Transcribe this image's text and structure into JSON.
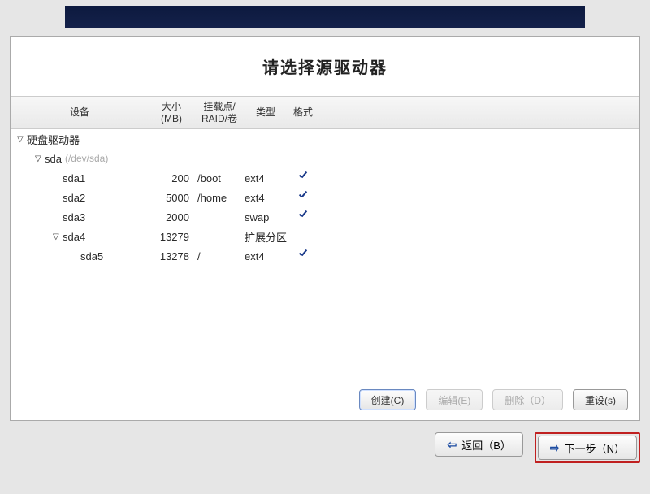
{
  "title": "请选择源驱动器",
  "columns": {
    "device": "设备",
    "size": "大小\n(MB)",
    "mount": "挂载点/\nRAID/卷",
    "type": "类型",
    "format": "格式"
  },
  "tree": {
    "root_label": "硬盘驱动器",
    "disk": {
      "name": "sda",
      "path": "(/dev/sda)"
    },
    "partitions": [
      {
        "name": "sda1",
        "size": "200",
        "mount": "/boot",
        "type": "ext4",
        "format": true,
        "indent": 2,
        "expandable": false
      },
      {
        "name": "sda2",
        "size": "5000",
        "mount": "/home",
        "type": "ext4",
        "format": true,
        "indent": 2,
        "expandable": false
      },
      {
        "name": "sda3",
        "size": "2000",
        "mount": "",
        "type": "swap",
        "format": true,
        "indent": 2,
        "expandable": false
      },
      {
        "name": "sda4",
        "size": "13279",
        "mount": "",
        "type": "扩展分区",
        "format": false,
        "indent": 2,
        "expandable": true
      },
      {
        "name": "sda5",
        "size": "13278",
        "mount": "/",
        "type": "ext4",
        "format": true,
        "indent": 3,
        "expandable": false
      }
    ]
  },
  "actions": {
    "create": "创建(C)",
    "edit": "编辑(E)",
    "delete": "删除（D）",
    "reset": "重设(s)"
  },
  "nav": {
    "back": "返回（B）",
    "next": "下一步（N）"
  }
}
